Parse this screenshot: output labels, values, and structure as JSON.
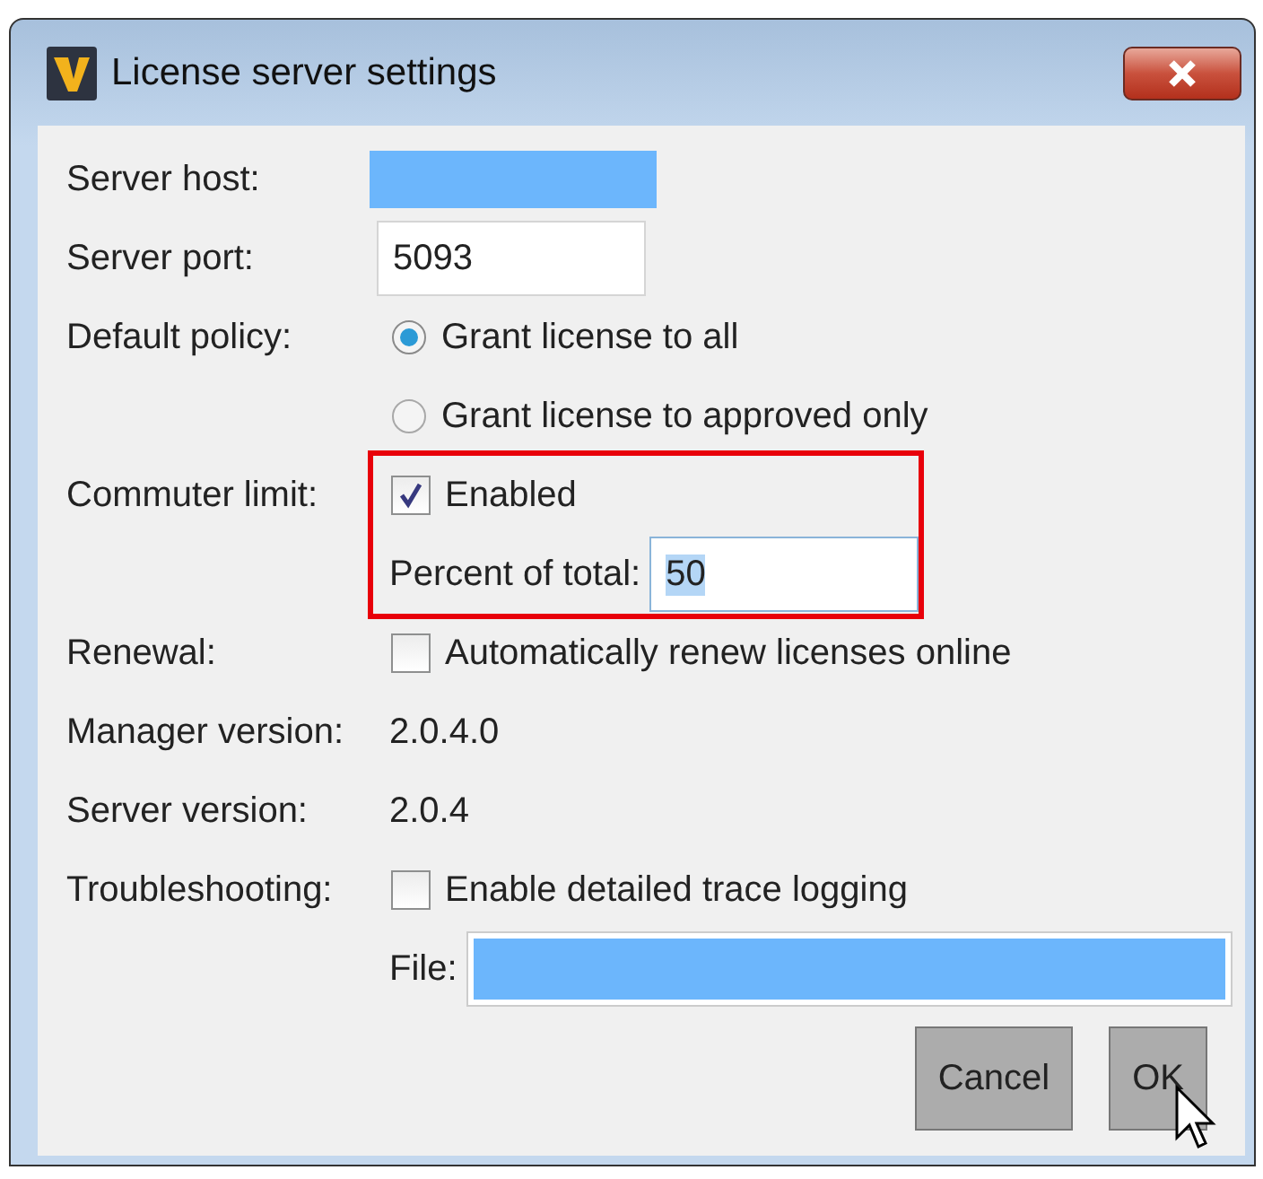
{
  "window": {
    "title": "License server settings"
  },
  "rows": [
    {
      "kind": "redacted-field",
      "label": "Server host:"
    },
    {
      "kind": "text-field",
      "label": "Server port:",
      "value": "5093"
    },
    {
      "kind": "radio-group",
      "label": "Default policy:",
      "options": [
        {
          "label": "Grant license to all",
          "selected": true
        },
        {
          "label": "Grant license to approved only",
          "selected": false
        }
      ]
    },
    {
      "kind": "checkbox",
      "label": "Commuter limit:",
      "highlighted": true,
      "checkbox": {
        "label": "Enabled",
        "checked": true
      },
      "subfield": {
        "kind": "text-field",
        "label": "Percent of total:",
        "value": "50",
        "text_selected": true
      }
    },
    {
      "kind": "checkbox",
      "label": "Renewal:",
      "checkbox": {
        "label": "Automatically renew licenses online",
        "checked": false
      }
    },
    {
      "kind": "text",
      "label": "Manager version:",
      "value": "2.0.4.0"
    },
    {
      "kind": "text",
      "label": "Server version:",
      "value": "2.0.4"
    },
    {
      "kind": "checkbox",
      "label": "Troubleshooting:",
      "checkbox": {
        "label": "Enable detailed trace logging",
        "checked": false
      },
      "subfield": {
        "kind": "redacted-field",
        "label": "File:"
      }
    }
  ],
  "buttons": [
    {
      "label": "Cancel"
    },
    {
      "label": "OK"
    }
  ]
}
